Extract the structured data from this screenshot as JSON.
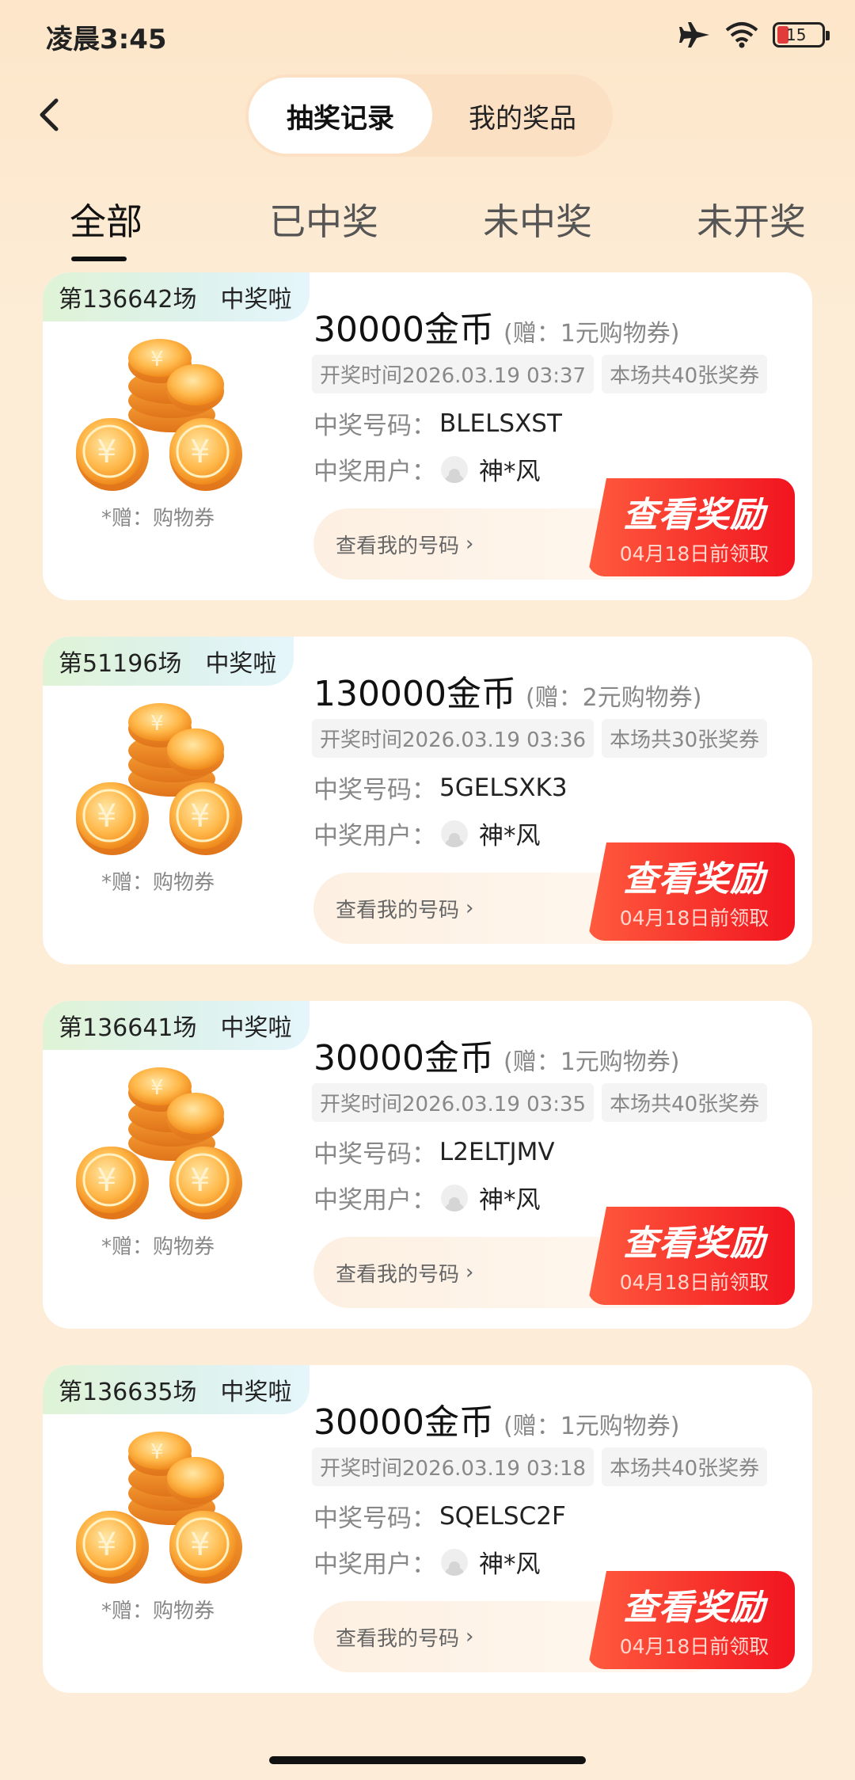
{
  "status": {
    "time": "凌晨3:45",
    "battery": "15"
  },
  "header": {
    "segments": [
      "抽奖记录",
      "我的奖品"
    ]
  },
  "tabs": [
    "全部",
    "已中奖",
    "未中奖",
    "未开奖"
  ],
  "colors": {
    "accent": "#f1141f",
    "background": "#fdecd6"
  },
  "cards": [
    {
      "round": "第136642场",
      "badge": "中奖啦",
      "gift": "*赠：购物券",
      "amount": "30000金币",
      "bonus": "(赠：1元购物券)",
      "draw_time": "开奖时间2026.03.19 03:37",
      "count": "本场共40张奖券",
      "code_label": "中奖号码：",
      "code": "BLELSXST",
      "user_label": "中奖用户：",
      "user": "神*风",
      "mycode": "查看我的号码",
      "reward": "查看奖励",
      "deadline": "04月18日前领取"
    },
    {
      "round": "第51196场",
      "badge": "中奖啦",
      "gift": "*赠：购物券",
      "amount": "130000金币",
      "bonus": "(赠：2元购物券)",
      "draw_time": "开奖时间2026.03.19 03:36",
      "count": "本场共30张奖券",
      "code_label": "中奖号码：",
      "code": "5GELSXK3",
      "user_label": "中奖用户：",
      "user": "神*风",
      "mycode": "查看我的号码",
      "reward": "查看奖励",
      "deadline": "04月18日前领取"
    },
    {
      "round": "第136641场",
      "badge": "中奖啦",
      "gift": "*赠：购物券",
      "amount": "30000金币",
      "bonus": "(赠：1元购物券)",
      "draw_time": "开奖时间2026.03.19 03:35",
      "count": "本场共40张奖券",
      "code_label": "中奖号码：",
      "code": "L2ELTJMV",
      "user_label": "中奖用户：",
      "user": "神*风",
      "mycode": "查看我的号码",
      "reward": "查看奖励",
      "deadline": "04月18日前领取"
    },
    {
      "round": "第136635场",
      "badge": "中奖啦",
      "gift": "*赠：购物券",
      "amount": "30000金币",
      "bonus": "(赠：1元购物券)",
      "draw_time": "开奖时间2026.03.19 03:18",
      "count": "本场共40张奖券",
      "code_label": "中奖号码：",
      "code": "SQELSC2F",
      "user_label": "中奖用户：",
      "user": "神*风",
      "mycode": "查看我的号码",
      "reward": "查看奖励",
      "deadline": "04月18日前领取"
    }
  ]
}
